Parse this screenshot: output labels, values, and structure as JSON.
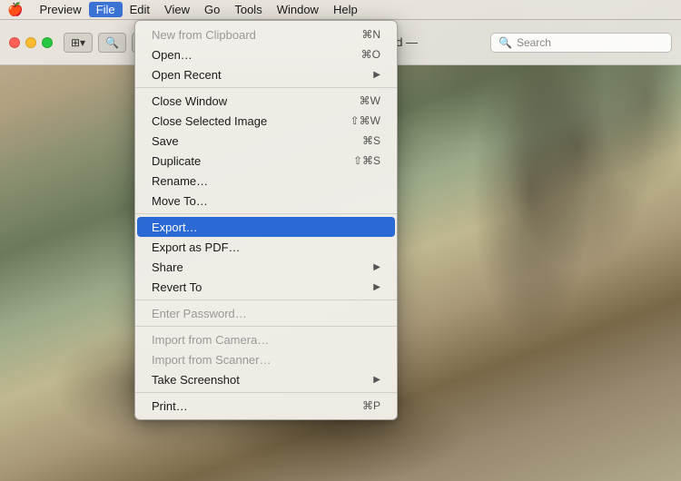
{
  "menuBar": {
    "apple": "🍎",
    "items": [
      {
        "label": "Preview",
        "active": false
      },
      {
        "label": "File",
        "active": true
      },
      {
        "label": "Edit",
        "active": false
      },
      {
        "label": "View",
        "active": false
      },
      {
        "label": "Go",
        "active": false
      },
      {
        "label": "Tools",
        "active": false
      },
      {
        "label": "Window",
        "active": false
      },
      {
        "label": "Help",
        "active": false
      }
    ]
  },
  "window": {
    "title": "— Locked —",
    "search_placeholder": "Search"
  },
  "fileMenu": {
    "items": [
      {
        "id": "new-clipboard",
        "label": "New from Clipboard",
        "shortcut": "⌘N",
        "disabled": true,
        "has_arrow": false,
        "separator_after": false
      },
      {
        "id": "open",
        "label": "Open…",
        "shortcut": "⌘O",
        "disabled": false,
        "has_arrow": false,
        "separator_after": false
      },
      {
        "id": "open-recent",
        "label": "Open Recent",
        "shortcut": "",
        "disabled": false,
        "has_arrow": true,
        "separator_after": true
      },
      {
        "id": "close-window",
        "label": "Close Window",
        "shortcut": "⌘W",
        "disabled": false,
        "has_arrow": false,
        "separator_after": false
      },
      {
        "id": "close-selected",
        "label": "Close Selected Image",
        "shortcut": "⇧⌘W",
        "disabled": false,
        "has_arrow": false,
        "separator_after": false
      },
      {
        "id": "save",
        "label": "Save",
        "shortcut": "⌘S",
        "disabled": false,
        "has_arrow": false,
        "separator_after": false
      },
      {
        "id": "duplicate",
        "label": "Duplicate",
        "shortcut": "⇧⌘S",
        "disabled": false,
        "has_arrow": false,
        "separator_after": false
      },
      {
        "id": "rename",
        "label": "Rename…",
        "shortcut": "",
        "disabled": false,
        "has_arrow": false,
        "separator_after": false
      },
      {
        "id": "move-to",
        "label": "Move To…",
        "shortcut": "",
        "disabled": false,
        "has_arrow": false,
        "separator_after": true
      },
      {
        "id": "export",
        "label": "Export…",
        "shortcut": "",
        "disabled": false,
        "has_arrow": false,
        "highlighted": true,
        "separator_after": false
      },
      {
        "id": "export-pdf",
        "label": "Export as PDF…",
        "shortcut": "",
        "disabled": false,
        "has_arrow": false,
        "separator_after": false
      },
      {
        "id": "share",
        "label": "Share",
        "shortcut": "",
        "disabled": false,
        "has_arrow": true,
        "separator_after": false
      },
      {
        "id": "revert-to",
        "label": "Revert To",
        "shortcut": "",
        "disabled": false,
        "has_arrow": true,
        "separator_after": true
      },
      {
        "id": "enter-password",
        "label": "Enter Password…",
        "shortcut": "",
        "disabled": true,
        "has_arrow": false,
        "separator_after": true
      },
      {
        "id": "import-camera",
        "label": "Import from Camera…",
        "shortcut": "",
        "disabled": true,
        "has_arrow": false,
        "separator_after": false
      },
      {
        "id": "import-scanner",
        "label": "Import from Scanner…",
        "shortcut": "",
        "disabled": true,
        "has_arrow": false,
        "separator_after": false
      },
      {
        "id": "take-screenshot",
        "label": "Take Screenshot",
        "shortcut": "",
        "disabled": false,
        "has_arrow": true,
        "separator_after": true
      },
      {
        "id": "print",
        "label": "Print…",
        "shortcut": "⌘P",
        "disabled": false,
        "has_arrow": false,
        "separator_after": false
      }
    ]
  }
}
